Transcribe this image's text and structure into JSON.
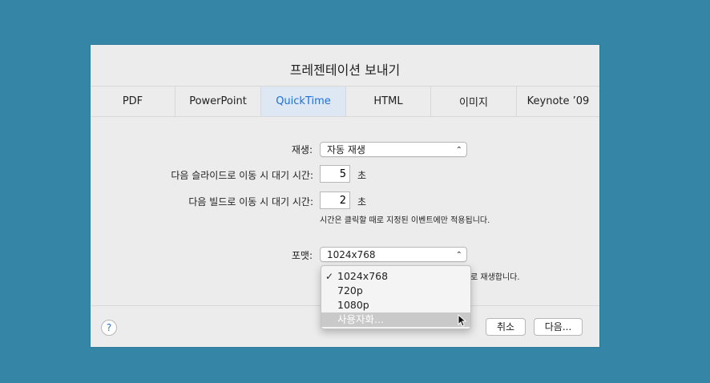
{
  "dialog": {
    "title": "프레젠테이션 보내기",
    "tabs": [
      "PDF",
      "PowerPoint",
      "QuickTime",
      "HTML",
      "이미지",
      "Keynote ’09"
    ],
    "active_tab": "QuickTime"
  },
  "form": {
    "playback": {
      "label": "재생:",
      "value": "자동 재생"
    },
    "slide_wait": {
      "label": "다음 슬라이드로 이동 시 대기 시간:",
      "value": "5",
      "unit": "초"
    },
    "build_wait": {
      "label": "다음 빌드로 이동 시 대기 시간:",
      "value": "2",
      "unit": "초"
    },
    "note": "시간은 클릭할 때로 지정된 이벤트에만 적용됩니다.",
    "format": {
      "label": "포맷:",
      "value": "1024x768",
      "behind_text": "로 재생합니다."
    }
  },
  "dropdown": {
    "items": [
      {
        "label": "1024x768",
        "checked": true
      },
      {
        "label": "720p",
        "checked": false
      },
      {
        "label": "1080p",
        "checked": false
      },
      {
        "label": "사용자화...",
        "checked": false
      }
    ],
    "check_glyph": "✓"
  },
  "footer": {
    "help_label": "?",
    "cancel": "취소",
    "next": "다음..."
  },
  "colors": {
    "background": "#3586a6",
    "accent": "#1f6fd6"
  }
}
